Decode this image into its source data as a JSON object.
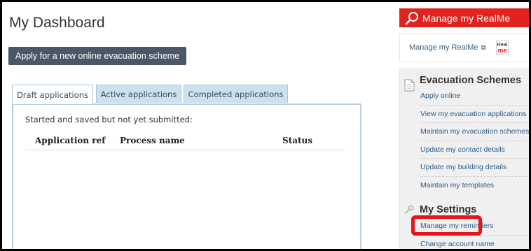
{
  "page": {
    "title": "My Dashboard"
  },
  "actions": {
    "apply_label": "Apply for a new online evacuation scheme"
  },
  "tabs": [
    {
      "label": "Draft applications",
      "active": true
    },
    {
      "label": "Active applications",
      "active": false
    },
    {
      "label": "Completed applications",
      "active": false
    }
  ],
  "panel": {
    "description": "Started and saved but not yet submitted:",
    "columns": [
      "Application ref",
      "Process name",
      "Status"
    ]
  },
  "sidebar": {
    "realme_header": "Manage my RealMe",
    "realme_link": "Manage my RealMe",
    "realme_logo": {
      "line1": "Real",
      "line2": "me"
    },
    "evac_title": "Evacuation Schemes",
    "evac_links": [
      "Apply online",
      "View my evacuation applications",
      "Maintain my evacuation schemes",
      "Update my contact details",
      "Update my building details",
      "Maintain my templates"
    ],
    "settings_title": "My Settings",
    "settings_links": [
      "Manage my reminders",
      "Change account name"
    ]
  },
  "colors": {
    "realme_red": "#e2221e",
    "button_dark": "#4a5866",
    "link_blue": "#2e5b87",
    "tab_blue": "#cde0ee",
    "highlight_red": "#e8141c"
  },
  "icons": [
    "search-icon",
    "external-link-icon",
    "realme-logo",
    "document-icon",
    "wrench-icon"
  ]
}
